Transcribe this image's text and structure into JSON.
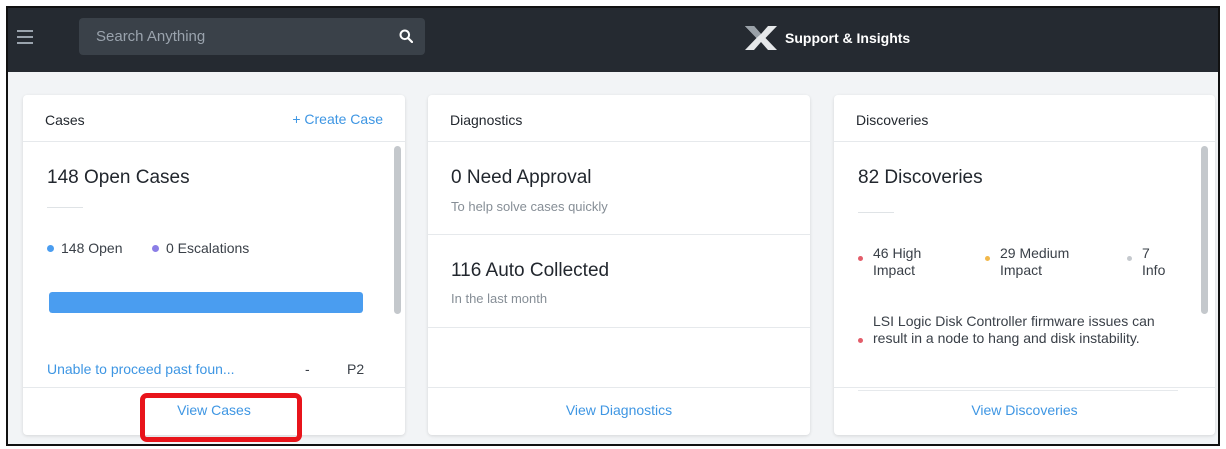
{
  "topbar": {
    "search_placeholder": "Search Anything",
    "brand_title": "Support & Insights"
  },
  "cases": {
    "title": "Cases",
    "action": "+ Create Case",
    "headline": "148 Open Cases",
    "open_label": "148 Open",
    "escalations_label": "0 Escalations",
    "open_fraction": 1.0,
    "case_title": "Unable to proceed past foun...",
    "case_dash": "-",
    "case_priority": "P2",
    "footer_link": "View Cases"
  },
  "diagnostics": {
    "title": "Diagnostics",
    "approval_headline": "0 Need Approval",
    "approval_sub": "To help solve cases quickly",
    "auto_headline": "116 Auto Collected",
    "auto_sub": "In the last month",
    "footer_link": "View Diagnostics"
  },
  "discoveries": {
    "title": "Discoveries",
    "headline": "82 Discoveries",
    "high_line1": "46 High",
    "high_line2": "Impact",
    "medium_line1": "29 Medium",
    "medium_line2": "Impact",
    "info_line1": "7",
    "info_line2": "Info",
    "issue_text": "LSI Logic Disk Controller firmware issues can result in a node to hang and disk instability.",
    "footer_link": "View Discoveries"
  },
  "colors": {
    "open_dot": "#4a9df0",
    "escalation_dot": "#8b7ee6",
    "high_dot": "#e35d6a",
    "medium_dot": "#f2b84b",
    "info_dot": "#c5c9ce",
    "annotation": "#e8141b"
  },
  "icons": {
    "menu": "hamburger-menu-icon",
    "search": "search-icon",
    "brand": "x-logo-icon"
  }
}
